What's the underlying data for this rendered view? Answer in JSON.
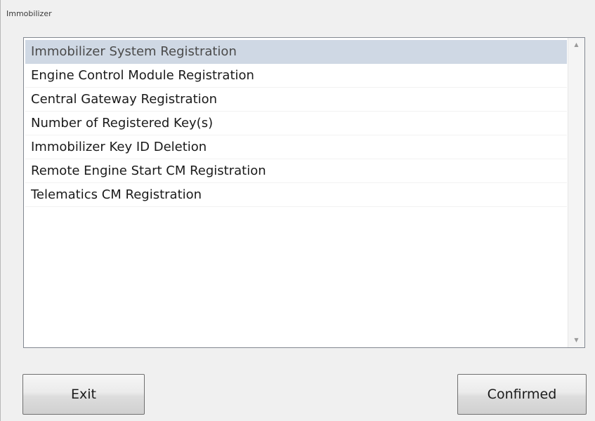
{
  "window": {
    "title": "Immobilizer"
  },
  "list": {
    "items": [
      {
        "label": "Immobilizer System Registration",
        "selected": true
      },
      {
        "label": "Engine Control Module Registration",
        "selected": false
      },
      {
        "label": "Central Gateway Registration",
        "selected": false
      },
      {
        "label": "Number of Registered Key(s)",
        "selected": false
      },
      {
        "label": "Immobilizer Key ID Deletion",
        "selected": false
      },
      {
        "label": "Remote Engine Start CM Registration",
        "selected": false
      },
      {
        "label": "Telematics CM Registration",
        "selected": false
      }
    ],
    "scroll_up_icon": "▲",
    "scroll_down_icon": "▼"
  },
  "buttons": {
    "exit_label": "Exit",
    "confirm_label": "Confirmed"
  },
  "colors": {
    "selection": "#cfd8e4",
    "window_bg": "#f0f0f0"
  }
}
